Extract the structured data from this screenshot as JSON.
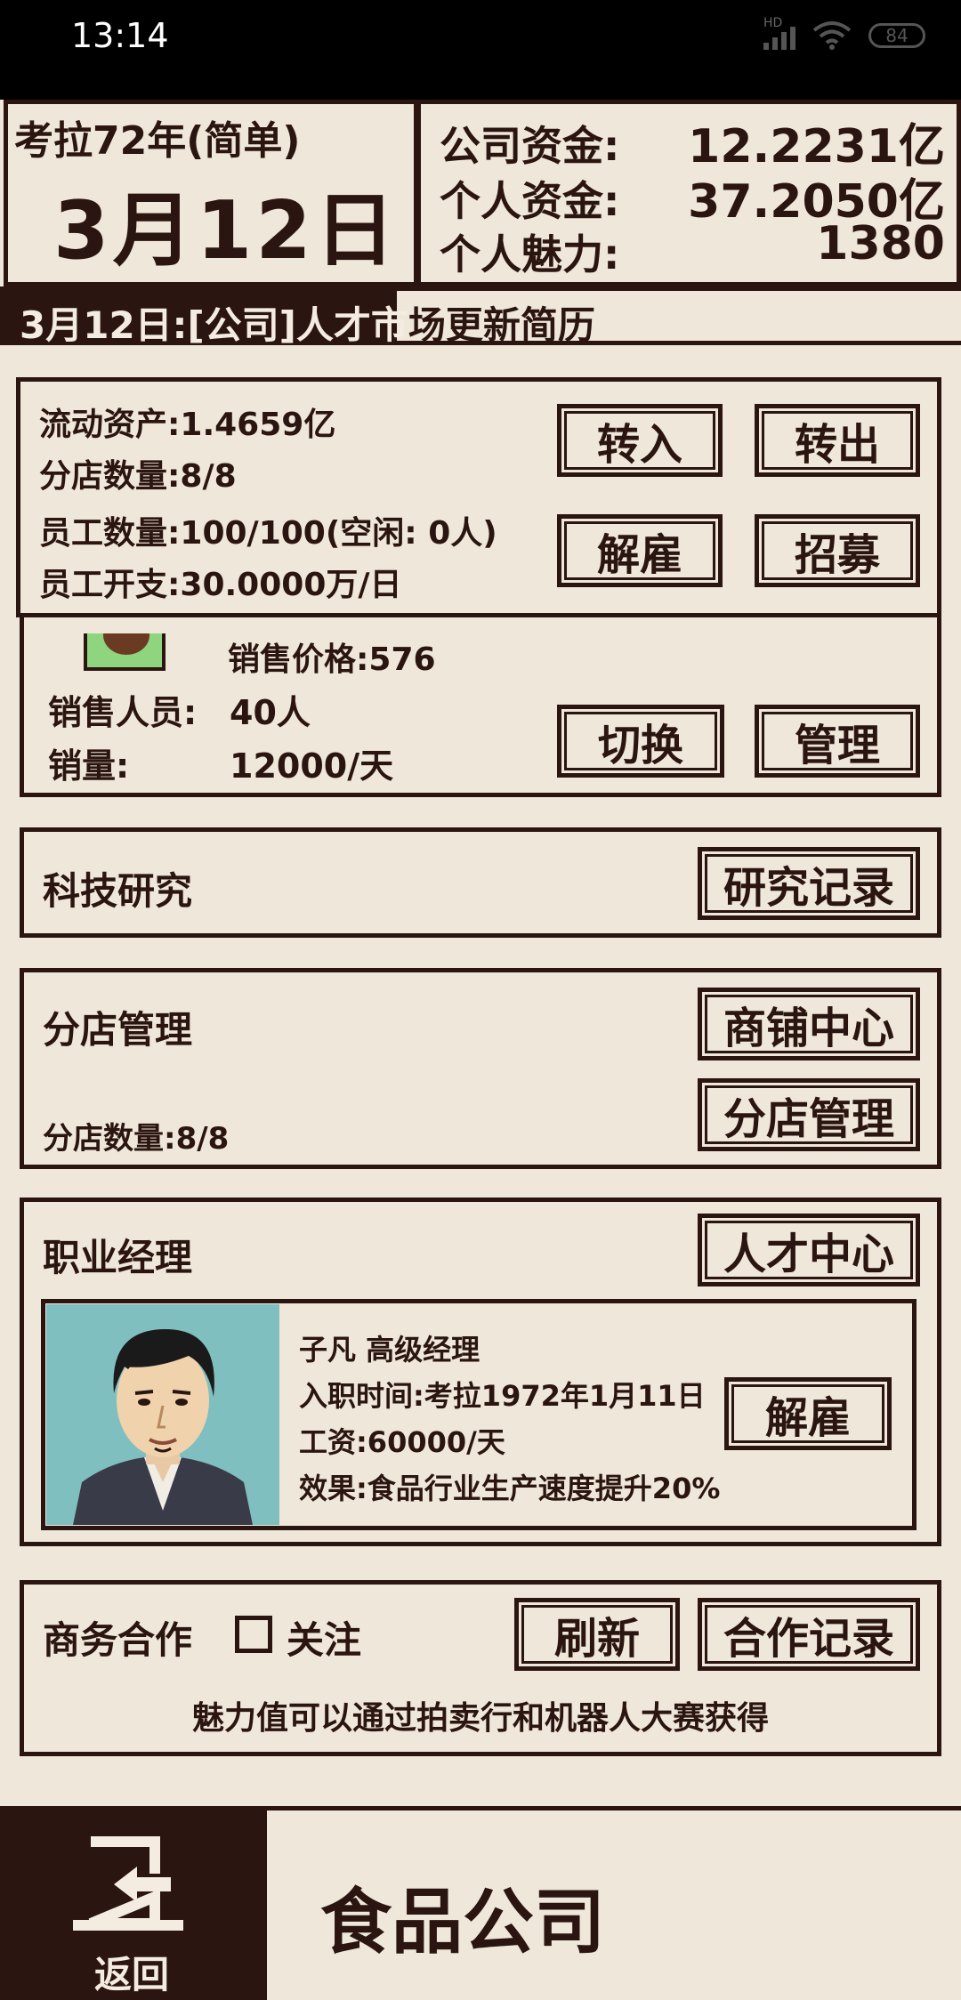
{
  "status": {
    "time": "13:14",
    "hd": "HD",
    "battery": "84"
  },
  "header": {
    "year_label": "考拉72年(简单)",
    "date": "3月12日",
    "company_funds_label": "公司资金:",
    "company_funds_value": "12.2231亿",
    "personal_funds_label": "个人资金:",
    "personal_funds_value": "37.2050亿",
    "charm_label": "个人魅力:",
    "charm_value": "1380"
  },
  "ticker": {
    "text_dark": "3月12日:[公司]人才市",
    "text_light": "场更新简历"
  },
  "assets": {
    "liquid_assets": "流动资产:1.4659亿",
    "branch_count": "分店数量:8/8",
    "employee_count": "员工数量:100/100(空闲: 0人)",
    "employee_cost": "员工开支:30.0000万/日",
    "transfer_in": "转入",
    "transfer_out": "转出",
    "fire": "解雇",
    "recruit": "招募"
  },
  "sales": {
    "price": "销售价格:576",
    "staff_label": "销售人员:",
    "staff_value": "40人",
    "volume_label": "销量:",
    "volume_value": "12000/天",
    "switch": "切换",
    "manage": "管理"
  },
  "research": {
    "title": "科技研究",
    "records": "研究记录"
  },
  "branches": {
    "title": "分店管理",
    "count": "分店数量:8/8",
    "shop_center": "商铺中心",
    "branch_manage": "分店管理"
  },
  "manager": {
    "title": "职业经理",
    "talent_center": "人才中心",
    "name": "子凡 高级经理",
    "hire_date": "入职时间:考拉1972年1月11日",
    "salary": "工资:60000/天",
    "effect": "效果:食品行业生产速度提升20%",
    "fire": "解雇"
  },
  "business": {
    "title": "商务合作",
    "follow": "关注",
    "refresh": "刷新",
    "records": "合作记录",
    "hint": "魅力值可以通过拍卖行和机器人大赛获得"
  },
  "bottom": {
    "back": "返回",
    "company": "食品公司"
  },
  "colors": {
    "background": "#efe7d9",
    "ink": "#2a1510",
    "portrait_bg": "#7fbfc0"
  }
}
